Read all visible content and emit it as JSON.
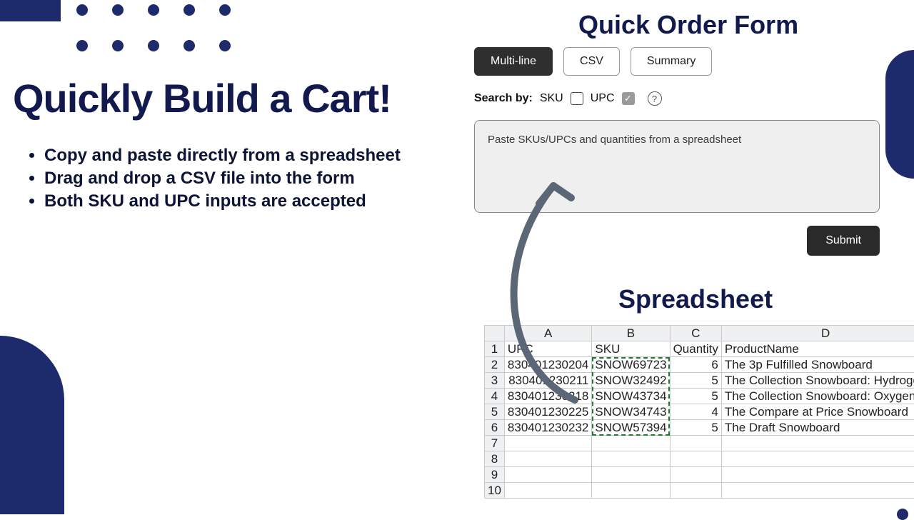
{
  "headline": "Quickly Build a Cart!",
  "bullets": [
    "Copy and paste directly from a spreadsheet",
    "Drag and drop a CSV file into the form",
    "Both SKU and UPC inputs are accepted"
  ],
  "form": {
    "title": "Quick Order Form",
    "tabs": {
      "multiline": "Multi-line",
      "csv": "CSV",
      "summary": "Summary"
    },
    "search_by_label": "Search by:",
    "sku_label": "SKU",
    "upc_label": "UPC",
    "sku_checked": false,
    "upc_checked": true,
    "paste_placeholder": "Paste SKUs/UPCs and quantities from a spreadsheet",
    "submit_label": "Submit"
  },
  "spreadsheet": {
    "title": "Spreadsheet",
    "columns": [
      "A",
      "B",
      "C",
      "D"
    ],
    "headers": {
      "A": "UPC",
      "B": "SKU",
      "C": "Quantity",
      "D": "ProductName"
    },
    "rows": [
      {
        "n": 1,
        "A": "UPC",
        "B": "SKU",
        "C": "Quantity",
        "D": "ProductName",
        "is_header": true
      },
      {
        "n": 2,
        "A": "830401230204",
        "B": "SNOW69723",
        "C": "6",
        "D": "The 3p Fulfilled Snowboard"
      },
      {
        "n": 3,
        "A": "830401230211",
        "B": "SNOW32492",
        "C": "5",
        "D": "The Collection Snowboard: Hydrogen"
      },
      {
        "n": 4,
        "A": "830401230218",
        "B": "SNOW43734",
        "C": "5",
        "D": "The Collection Snowboard: Oxygen"
      },
      {
        "n": 5,
        "A": "830401230225",
        "B": "SNOW34743",
        "C": "4",
        "D": "The Compare at Price Snowboard"
      },
      {
        "n": 6,
        "A": "830401230232",
        "B": "SNOW57394",
        "C": "5",
        "D": "The Draft Snowboard"
      },
      {
        "n": 7,
        "A": "",
        "B": "",
        "C": "",
        "D": ""
      },
      {
        "n": 8,
        "A": "",
        "B": "",
        "C": "",
        "D": ""
      },
      {
        "n": 9,
        "A": "",
        "B": "",
        "C": "",
        "D": ""
      },
      {
        "n": 10,
        "A": "",
        "B": "",
        "C": "",
        "D": ""
      }
    ],
    "selection": {
      "col": "B",
      "from_row": 2,
      "to_row": 6
    }
  }
}
